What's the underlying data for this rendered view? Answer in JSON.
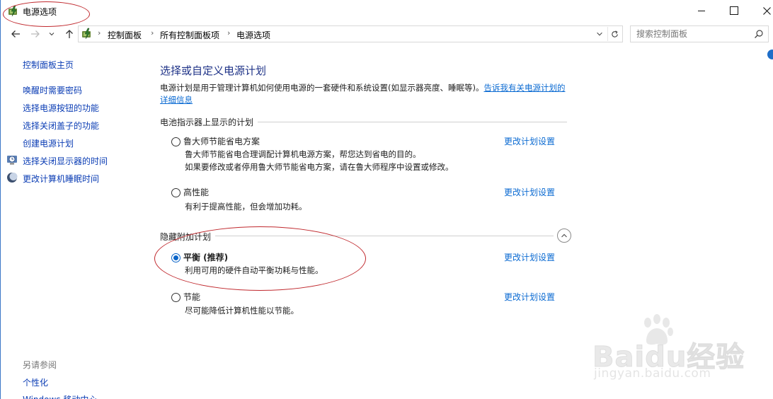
{
  "window": {
    "title": "电源选项",
    "annotation_color": "#c0282d"
  },
  "address_bar": {
    "crumbs": [
      "控制面板",
      "所有控制面板项",
      "电源选项"
    ],
    "separator": "›",
    "search_placeholder": "搜索控制面板"
  },
  "sidebar": {
    "home": "控制面板主页",
    "links": [
      "唤醒时需要密码",
      "选择电源按钮的功能",
      "选择关闭盖子的功能",
      "创建电源计划",
      "选择关闭显示器的时间",
      "更改计算机睡眠时间"
    ],
    "link_icons": [
      "",
      "",
      "",
      "",
      "clock-monitor-icon",
      "moon-icon"
    ],
    "see_also_title": "另请参阅",
    "see_also": [
      "个性化",
      "Windows 移动中心"
    ]
  },
  "main": {
    "title": "选择或自定义电源计划",
    "description": "电源计划是用于管理计算机如何使用电源的一套硬件和系统设置(如显示器亮度、睡眠等)。",
    "description_link": "告诉我有关电源计划的详细信息",
    "battery_group_title": "电池指示器上显示的计划",
    "hidden_group_title": "隐藏附加计划",
    "change_label": "更改计划设置",
    "plans": [
      {
        "name": "鲁大师节能省电方案",
        "selected": false,
        "desc": [
          "鲁大师节能省电合理调配计算机电源方案，帮您达到省电的目的。",
          "如果要修改或者停用鲁大师节能省电方案，请在鲁大师程序中设置或修改。"
        ]
      },
      {
        "name": "高性能",
        "selected": false,
        "desc": [
          "有利于提高性能，但会增加功耗。"
        ]
      },
      {
        "name": "平衡 (推荐)",
        "selected": true,
        "desc": [
          "利用可用的硬件自动平衡功耗与性能。"
        ]
      },
      {
        "name": "节能",
        "selected": false,
        "desc": [
          "尽可能降低计算机性能以节能。"
        ]
      }
    ]
  },
  "watermark": {
    "brand": "Baidu经验",
    "domain": "jingyan.baidu.com"
  },
  "colors": {
    "link": "#0a3cb4",
    "accent": "#0a64c8",
    "title": "#1e3287"
  }
}
